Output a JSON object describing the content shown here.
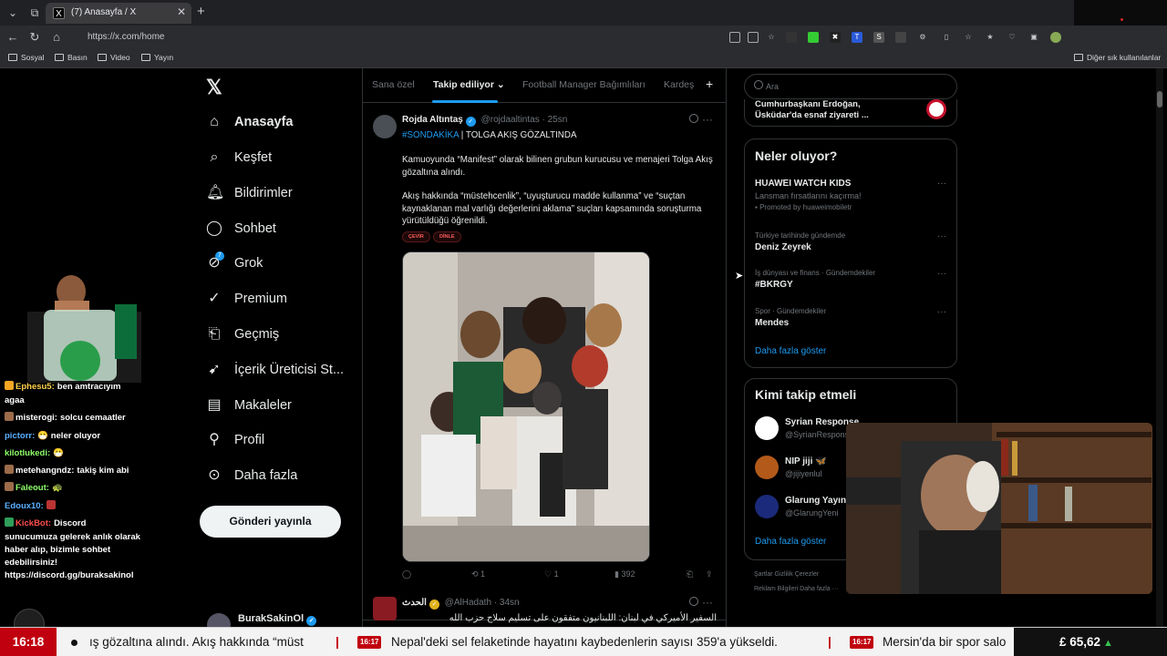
{
  "browser": {
    "tab_title": "(7) Anasayfa / X",
    "url": "https://x.com/home",
    "bookmarks": [
      "Sosyal",
      "Basın",
      "Video",
      "Yayın"
    ],
    "other_bookmarks": "Diğer sık kullanılanlar"
  },
  "x": {
    "logo": "𝕏",
    "nav": [
      {
        "label": "Anasayfa",
        "icon": "home-icon"
      },
      {
        "label": "Keşfet",
        "icon": "search-icon"
      },
      {
        "label": "Bildirimler",
        "icon": "bell-icon"
      },
      {
        "label": "Sohbet",
        "icon": "chat-icon"
      },
      {
        "label": "Grok",
        "icon": "grok-icon"
      },
      {
        "label": "Premium",
        "icon": "premium-icon"
      },
      {
        "label": "Geçmiş",
        "icon": "bookmark-icon"
      },
      {
        "label": "İçerik Üreticisi St...",
        "icon": "rocket-icon"
      },
      {
        "label": "Makaleler",
        "icon": "article-icon"
      },
      {
        "label": "Profil",
        "icon": "user-icon"
      },
      {
        "label": "Daha fazla",
        "icon": "more-icon"
      }
    ],
    "notification_count": "7",
    "post_button": "Gönderi yayınla",
    "account_name": "BurakSakinOl"
  },
  "timeline": {
    "tabs": [
      "Sana özel",
      "Takip ediliyor",
      "Football Manager Bağımlıları",
      "Kardeş"
    ],
    "tweet1": {
      "name": "Rojda Altıntaş",
      "handle": "@rojdaaltintas · 25sn",
      "hashtag": "#SONDAKİKA",
      "headline": " | TOLGA AKIŞ GÖZALTINDA",
      "para1": "Kamuoyunda “Manifest” olarak bilinen grubun kurucusu ve menajeri Tolga Akış gözaltına alındı.",
      "para2": "Akış hakkında “müstehcenlik”, “uyuşturucu madde kullanma” ve “suçtan kaynaklanan mal varlığı değerlerini aklama” suçları kapsamında soruşturma yürütüldüğü öğrenildi.",
      "pill1": "ÇEVİR",
      "pill2": "DİNLE",
      "replies": "",
      "reposts": "1",
      "likes": "1",
      "views": "392"
    },
    "tweet2": {
      "name": "الحدث",
      "handle": "@AlHadath · 34sn",
      "text": "السفير الأميركي في لبنان: اللبنانيون متفقون على تسليم سلاح حزب الله"
    }
  },
  "sidebar": {
    "search_placeholder": "Ara",
    "news_snippet": "Cumhurbaşkanı Erdoğan, Üsküdar'da esnaf ziyareti ...",
    "trends_title": "Neler oluyor?",
    "trends": [
      {
        "meta": "",
        "name": "HUAWEI WATCH KIDS",
        "sub": "Lansman fırsatlarını kaçırma!",
        "promo": "Promoted by huaweimobiletr"
      },
      {
        "meta": "Türkiye tarihinde gündemde",
        "name": "Deniz Zeyrek",
        "sub": "",
        "promo": ""
      },
      {
        "meta": "İş dünyası ve finans · Gündemdekiler",
        "name": "#BKRGY",
        "sub": "",
        "promo": ""
      },
      {
        "meta": "Spor · Gündemdekiler",
        "name": "Mendes",
        "sub": "",
        "promo": ""
      }
    ],
    "show_more": "Daha fazla göster",
    "who_to_follow_title": "Kimi takip etmeli",
    "follow": [
      {
        "name": "Syrian Response",
        "handle": "@SyrianRespons"
      },
      {
        "name": "NIP jiji 🦋",
        "handle": "@jijiyenlul"
      },
      {
        "name": "Glarung Yayın",
        "handle": "@GlarungYeni"
      }
    ],
    "show_more2": "Daha fazla göster",
    "footer1": "Şartlar     Gizlilik     Çerezler",
    "footer2": "Reklam Bilgileri     Daha fazla ···"
  },
  "chat": [
    {
      "user": "Ephesu5:",
      "msg": "ben amtracıyım",
      "color": "#ffd34d"
    },
    {
      "user": "",
      "msg": "agaa",
      "color": "#ffffff"
    },
    {
      "user": "misterogi:",
      "msg": "solcu cemaatler",
      "color": "#ffffff"
    },
    {
      "user": "pictorr:",
      "msg": "😷 neler oluyor",
      "color": "#5ab0ff"
    },
    {
      "user": "kilotlukedi:",
      "msg": "😷",
      "color": "#8dff6a"
    },
    {
      "user": "metehangndz:",
      "msg": "takiş kim abi",
      "color": "#ffffff"
    },
    {
      "user": "Faleout:",
      "msg": "🐢",
      "color": "#8dff6a"
    },
    {
      "user": "Edoux10:",
      "msg": "",
      "color": "#5ab0ff"
    },
    {
      "user": "KickBot:",
      "msg": "Discord",
      "color": "#ff4d4d"
    },
    {
      "user": "",
      "msg": "sunucumuza gelerek anlık olarak",
      "color": "#ffffff"
    },
    {
      "user": "",
      "msg": "haber alıp, bizimle sohbet",
      "color": "#ffffff"
    },
    {
      "user": "",
      "msg": "edebilirsiniz!",
      "color": "#ffffff"
    },
    {
      "user": "",
      "msg": "https://discord.gg/buraksakinol",
      "color": "#ffffff"
    }
  ],
  "ticker": {
    "time": "16:18",
    "item1": "ış gözaltına alındı. Akış hakkında “müst",
    "badge_time": "16:17",
    "item2": "Nepal'deki sel felaketinde hayatını kaybedenlerin sayısı 359'a yükseldi.",
    "badge_time2": "16:17",
    "item3": "Mersin'da bir spor salo",
    "price": "£ 65,62",
    "trend": "▲"
  }
}
